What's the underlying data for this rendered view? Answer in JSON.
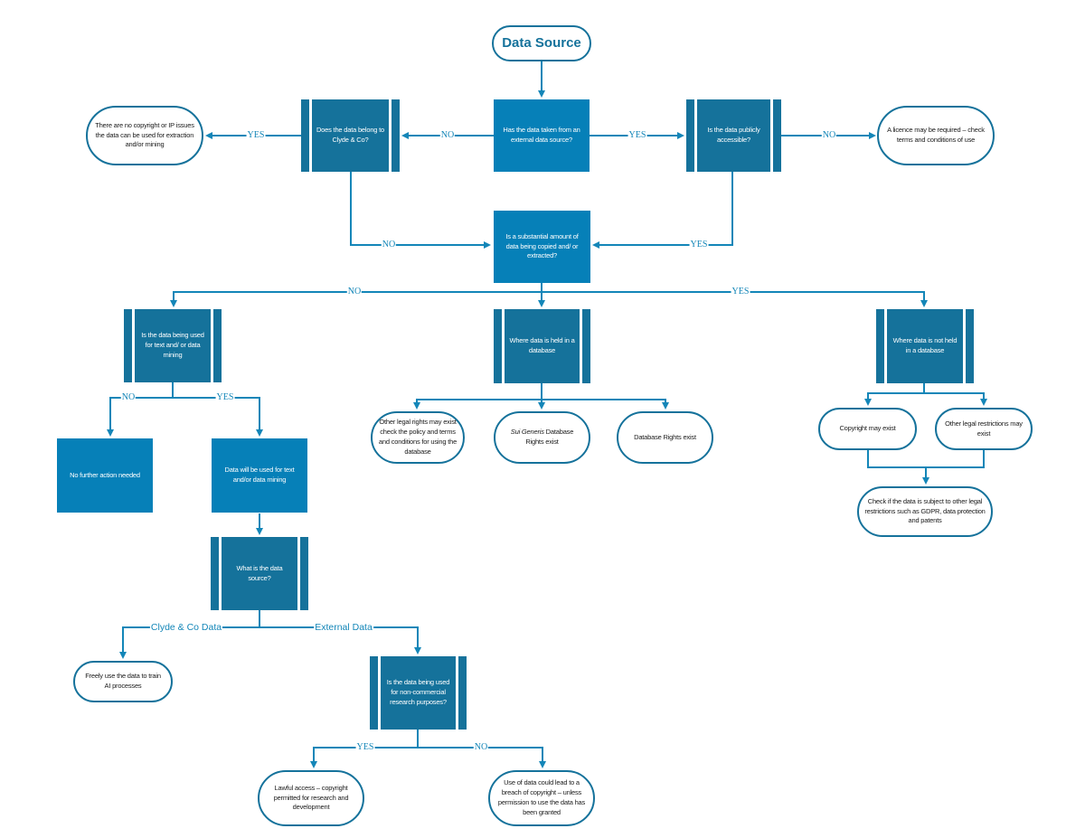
{
  "diagram": {
    "start": "Data Source",
    "nodes": {
      "external_source_q": "Has the data taken from an external data source?",
      "belongs_to_clyde_q": "Does the data belong to Clyde & Co?",
      "no_ip_issues": "There are no copyright or IP issues the data can be used for extraction and/or mining",
      "publicly_accessible_q": "Is the data publicly accessible?",
      "licence_required": "A licence may be required – check terms and conditions of use",
      "substantial_amount_q": "Is a substantial amount of data being copied and/ or extracted?",
      "text_mining_q": "Is the data being used for text and/ or data mining",
      "held_in_database": "Where data is held in a database",
      "not_held_in_database": "Where data is not held in a database",
      "no_further_action": "No further action needed",
      "will_be_used_mining": "Data will be used for text and/or data mining",
      "other_legal_rights": "Other legal rights may exist check the policy and terms and conditions for using the database",
      "sui_generis_prefix": "Sui Generis",
      "sui_generis_suffix": " Database Rights exist",
      "database_rights": "Database Rights exist",
      "copyright_may_exist": "Copyright may exist",
      "other_legal_restrictions": "Other legal restrictions may exist",
      "check_gdpr": "Check if the data is subject to other legal restrictions such as GDPR, data protection and patents",
      "what_is_source_q": "What is the data source?",
      "freely_use": "Freely use the data to train AI processes",
      "non_commercial_q": "Is the data being used for non-commercial research purposes?",
      "lawful_access": "Lawful access – copyright permitted for research and development",
      "breach_copyright": "Use of data could lead to a breach of copyright – unless permission to use the data has been granted"
    },
    "edge_labels": {
      "yes": "YES",
      "no": "NO",
      "clyde_data": "Clyde & Co Data",
      "external_data": "External Data"
    },
    "colors": {
      "process": "#0680b8",
      "predefined": "#15729b",
      "connector": "#1386b8",
      "terminator_border": "#15729b"
    }
  }
}
